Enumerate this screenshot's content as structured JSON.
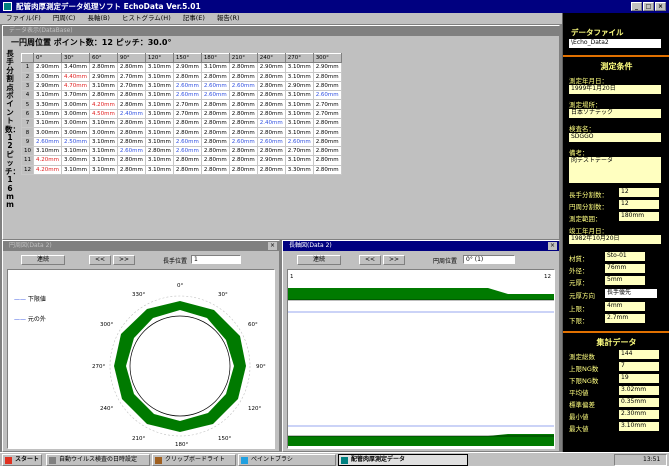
{
  "app": {
    "title": "配管肉厚測定データ処理ソフト EchoData Ver.5.01",
    "menu": [
      "ファイル(F)",
      "円周(C)",
      "長軸(B)",
      "ヒストグラム(H)",
      "記事(E)",
      "報告(R)"
    ]
  },
  "grid_window": {
    "title": "データ表示(DataBase)",
    "header": "一円周位置 ポイント数：12 ピッチ：30.0°",
    "side_label": "長手分割点ポイント数：12 ピッチ：16mm",
    "columns": [
      "",
      "0°",
      "30°",
      "60°",
      "90°",
      "120°",
      "150°",
      "180°",
      "210°",
      "240°",
      "270°",
      "300°"
    ],
    "rows": [
      [
        "1",
        "2.90mm",
        "3.40mm",
        "2.80mm",
        "2.80mm",
        "3.10mm",
        "2.90mm",
        "3.10mm",
        "2.80mm",
        "2.90mm",
        "3.10mm",
        "2.90mm"
      ],
      [
        "2",
        "3.00mm",
        "4.40mm",
        "2.90mm",
        "2.70mm",
        "3.10mm",
        "2.80mm",
        "2.80mm",
        "2.80mm",
        "2.80mm",
        "3.10mm",
        "2.80mm"
      ],
      [
        "3",
        "2.90mm",
        "4.70mm",
        "3.10mm",
        "2.70mm",
        "3.10mm",
        "2.60mm",
        "2.60mm",
        "2.60mm",
        "2.80mm",
        "2.90mm",
        "2.80mm"
      ],
      [
        "4",
        "3.10mm",
        "3.70mm",
        "2.80mm",
        "2.80mm",
        "3.10mm",
        "2.60mm",
        "2.60mm",
        "2.80mm",
        "2.80mm",
        "3.10mm",
        "2.60mm"
      ],
      [
        "5",
        "3.30mm",
        "3.00mm",
        "4.20mm",
        "2.80mm",
        "3.10mm",
        "2.70mm",
        "2.80mm",
        "2.80mm",
        "2.80mm",
        "3.10mm",
        "2.70mm"
      ],
      [
        "6",
        "3.10mm",
        "3.00mm",
        "4.50mm",
        "2.40mm",
        "3.10mm",
        "2.70mm",
        "2.80mm",
        "2.80mm",
        "2.80mm",
        "3.10mm",
        "2.70mm"
      ],
      [
        "7",
        "3.10mm",
        "3.00mm",
        "3.10mm",
        "2.80mm",
        "3.10mm",
        "2.80mm",
        "2.80mm",
        "2.80mm",
        "2.40mm",
        "3.10mm",
        "2.80mm"
      ],
      [
        "8",
        "3.00mm",
        "3.00mm",
        "3.00mm",
        "2.80mm",
        "3.10mm",
        "2.80mm",
        "2.80mm",
        "2.80mm",
        "2.80mm",
        "3.10mm",
        "2.80mm"
      ],
      [
        "9",
        "2.60mm",
        "2.50mm",
        "3.10mm",
        "2.80mm",
        "3.10mm",
        "2.60mm",
        "2.80mm",
        "2.60mm",
        "2.60mm",
        "2.60mm",
        "2.80mm"
      ],
      [
        "10",
        "3.10mm",
        "3.10mm",
        "3.10mm",
        "2.60mm",
        "2.80mm",
        "2.60mm",
        "2.80mm",
        "2.80mm",
        "2.80mm",
        "2.70mm",
        "2.80mm"
      ],
      [
        "11",
        "4.20mm",
        "3.00mm",
        "3.10mm",
        "2.80mm",
        "3.10mm",
        "2.80mm",
        "2.80mm",
        "2.80mm",
        "2.90mm",
        "3.10mm",
        "2.80mm"
      ],
      [
        "12",
        "4.20mm",
        "3.10mm",
        "3.10mm",
        "2.80mm",
        "3.10mm",
        "2.80mm",
        "2.80mm",
        "2.80mm",
        "2.80mm",
        "3.30mm",
        "2.80mm"
      ]
    ]
  },
  "circ_window": {
    "title": "円周図(Data 2)",
    "run_label": "連続",
    "prev_label": "<<",
    "next_label": ">>",
    "pos_label": "長手位置",
    "pos_value": "1",
    "legend_lower": "下限値",
    "legend_outer": "元の外",
    "angles": [
      "0°",
      "30°",
      "60°",
      "90°",
      "120°",
      "150°",
      "180°",
      "210°",
      "240°",
      "270°",
      "300°",
      "330°"
    ]
  },
  "long_window": {
    "title": "長軸図(Data 2)",
    "run_label": "連続",
    "prev_label": "<<",
    "next_label": ">>",
    "pos_label": "円周位置",
    "pos_value": "0° (1)",
    "left_tick": "1",
    "right_tick": "12"
  },
  "right_panel": {
    "data_file_label": "データファイル",
    "data_file_value": "\\Echo_Data2",
    "cond_title": "測定条件",
    "date_label": "測定年月日：",
    "date_value": "1999年1月20日",
    "place_label": "測定場所：",
    "place_value": "日本ソナテック",
    "name_label": "検査名：",
    "name_value": "SDGGO",
    "note_label": "備考：",
    "note_value": "肉テストデータ",
    "long_div_label": "長手分割数：",
    "long_div_value": "12",
    "circ_div_label": "円周分割数：",
    "circ_div_value": "12",
    "range_label": "測定範囲：",
    "range_value": "180mm",
    "built_label": "竣工年月日：",
    "built_value": "1982年10月20日",
    "mat_label": "材質：",
    "mat_value": "Sto-01",
    "od_label": "外径：",
    "od_value": "76mm",
    "wall_label": "元厚：",
    "wall_value": "5mm",
    "dir_label": "元厚方向",
    "dir_value": "長手優先",
    "upper_label": "上限：",
    "upper_value": "4mm",
    "lower_label": "下限：",
    "lower_value": "2.7mm",
    "stats_title": "集計データ",
    "total_label": "測定総数",
    "total_value": "144",
    "ng_up_label": "上限NG数",
    "ng_up_value": "7",
    "ng_low_label": "下限NG数",
    "ng_low_value": "19",
    "avg_label": "平均値",
    "avg_value": "3.02mm",
    "std_label": "標準偏差",
    "std_value": "0.35mm",
    "min_label": "最小値",
    "min_value": "2.30mm",
    "max_label": "最大値",
    "max_value": "3.10mm"
  },
  "taskbar": {
    "start": "スタート",
    "tasks": [
      "自動ウイルス検査の日時設定",
      "クリップボードライト",
      "ペイントブラシ",
      "配管肉厚測定データ"
    ],
    "time": "13:51"
  }
}
